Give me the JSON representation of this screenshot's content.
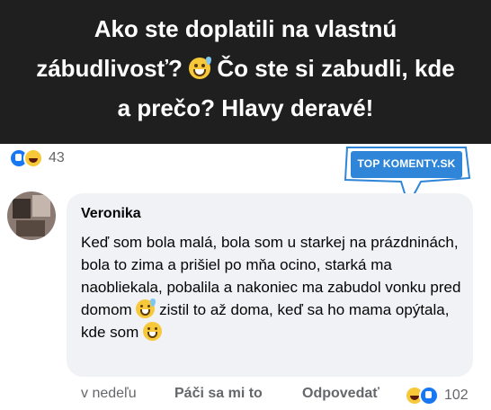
{
  "post": {
    "title_part1": "Ako ste doplatili na vlastnú zábudlivosť?",
    "title_part2": "Čo ste si zabudli, kde a prečo? Hlavy deravé!",
    "reaction_count": "43"
  },
  "brand": {
    "name": "TOP KOMENTY.SK"
  },
  "comment": {
    "author": "Veronika",
    "text_part1": "Keď som bola malá, bola som u starkej na prázdninách, bola to zima a prišiel po mňa ocino, starká ma naobliekala, pobalila a nakoniec ma zabudol vonku pred domom",
    "text_part2": "zistil to až doma, keď sa ho mama opýtala, kde som"
  },
  "actions": {
    "time": "v nedeľu",
    "like_label": "Páči sa mi to",
    "reply_label": "Odpovedať",
    "reaction_count": "102"
  },
  "colors": {
    "banner_bg": "#1f1f1f",
    "bubble_bg": "#f0f2f5",
    "brand_blue": "#2f86d8",
    "like_blue": "#1877f2",
    "muted_text": "#65676b"
  },
  "icons": [
    "grinning-sweat-emoji",
    "grinning-emoji",
    "like-reaction-icon",
    "haha-reaction-icon"
  ]
}
